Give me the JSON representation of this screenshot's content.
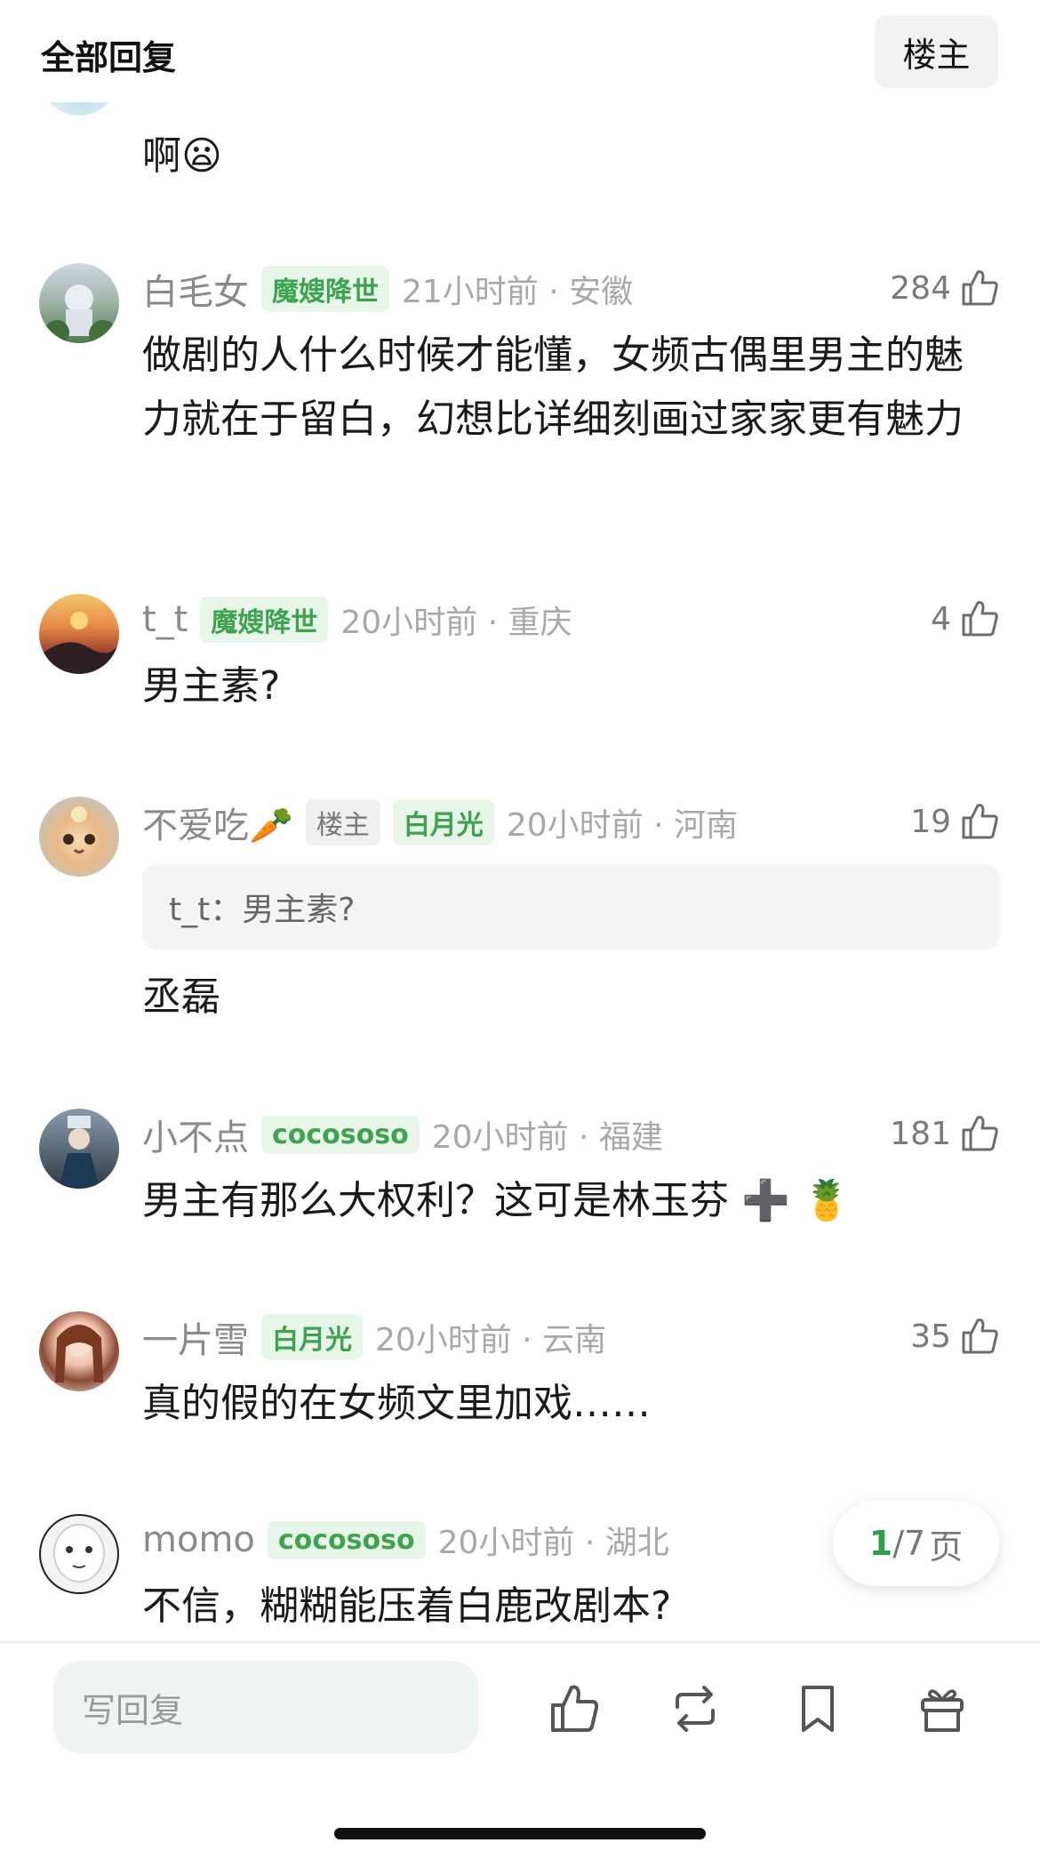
{
  "header": {
    "title": "全部回复",
    "op_filter": "楼主"
  },
  "comments": [
    {
      "text": "啊😦"
    },
    {
      "username": "白毛女",
      "badges": [
        "魔嫂降世"
      ],
      "time": "21小时前 · 安徽",
      "likes": "284",
      "text": "做剧的人什么时候才能懂，女频古偶里男主的魅力就在于留白，幻想比详细刻画过家家更有魅力"
    },
    {
      "username": "t_t",
      "badges": [
        "魔嫂降世"
      ],
      "time": "20小时前 · 重庆",
      "likes": "4",
      "text": "男主素?"
    },
    {
      "username": "不爱吃🥕",
      "badges": [
        "楼主",
        "白月光"
      ],
      "time": "20小时前 · 河南",
      "likes": "19",
      "quote": "t_t：男主素?",
      "text": "丞磊"
    },
    {
      "username": "小不点",
      "badges": [
        "cocososo"
      ],
      "time": "20小时前 · 福建",
      "likes": "181",
      "text": "男主有那么大权利？这可是林玉芬 ➕ 🍍"
    },
    {
      "username": "一片雪",
      "badges": [
        "白月光"
      ],
      "time": "20小时前 · 云南",
      "likes": "35",
      "text": "真的假的在女频文里加戏……"
    },
    {
      "username": "momo",
      "badges": [
        "cocososo"
      ],
      "time": "20小时前 · 湖北",
      "text": "不信，糊糊能压着白鹿改剧本?"
    }
  ],
  "pager": {
    "current": "1",
    "total": "/7",
    "unit": "页"
  },
  "bottom_bar": {
    "reply_placeholder": "写回复",
    "icons": [
      "like-icon",
      "repost-icon",
      "bookmark-icon",
      "gift-icon"
    ]
  },
  "colors": {
    "accent_green": "#3da34f",
    "badge_bg": "#e8f6ea",
    "meta_grey": "#a8a8a8"
  }
}
